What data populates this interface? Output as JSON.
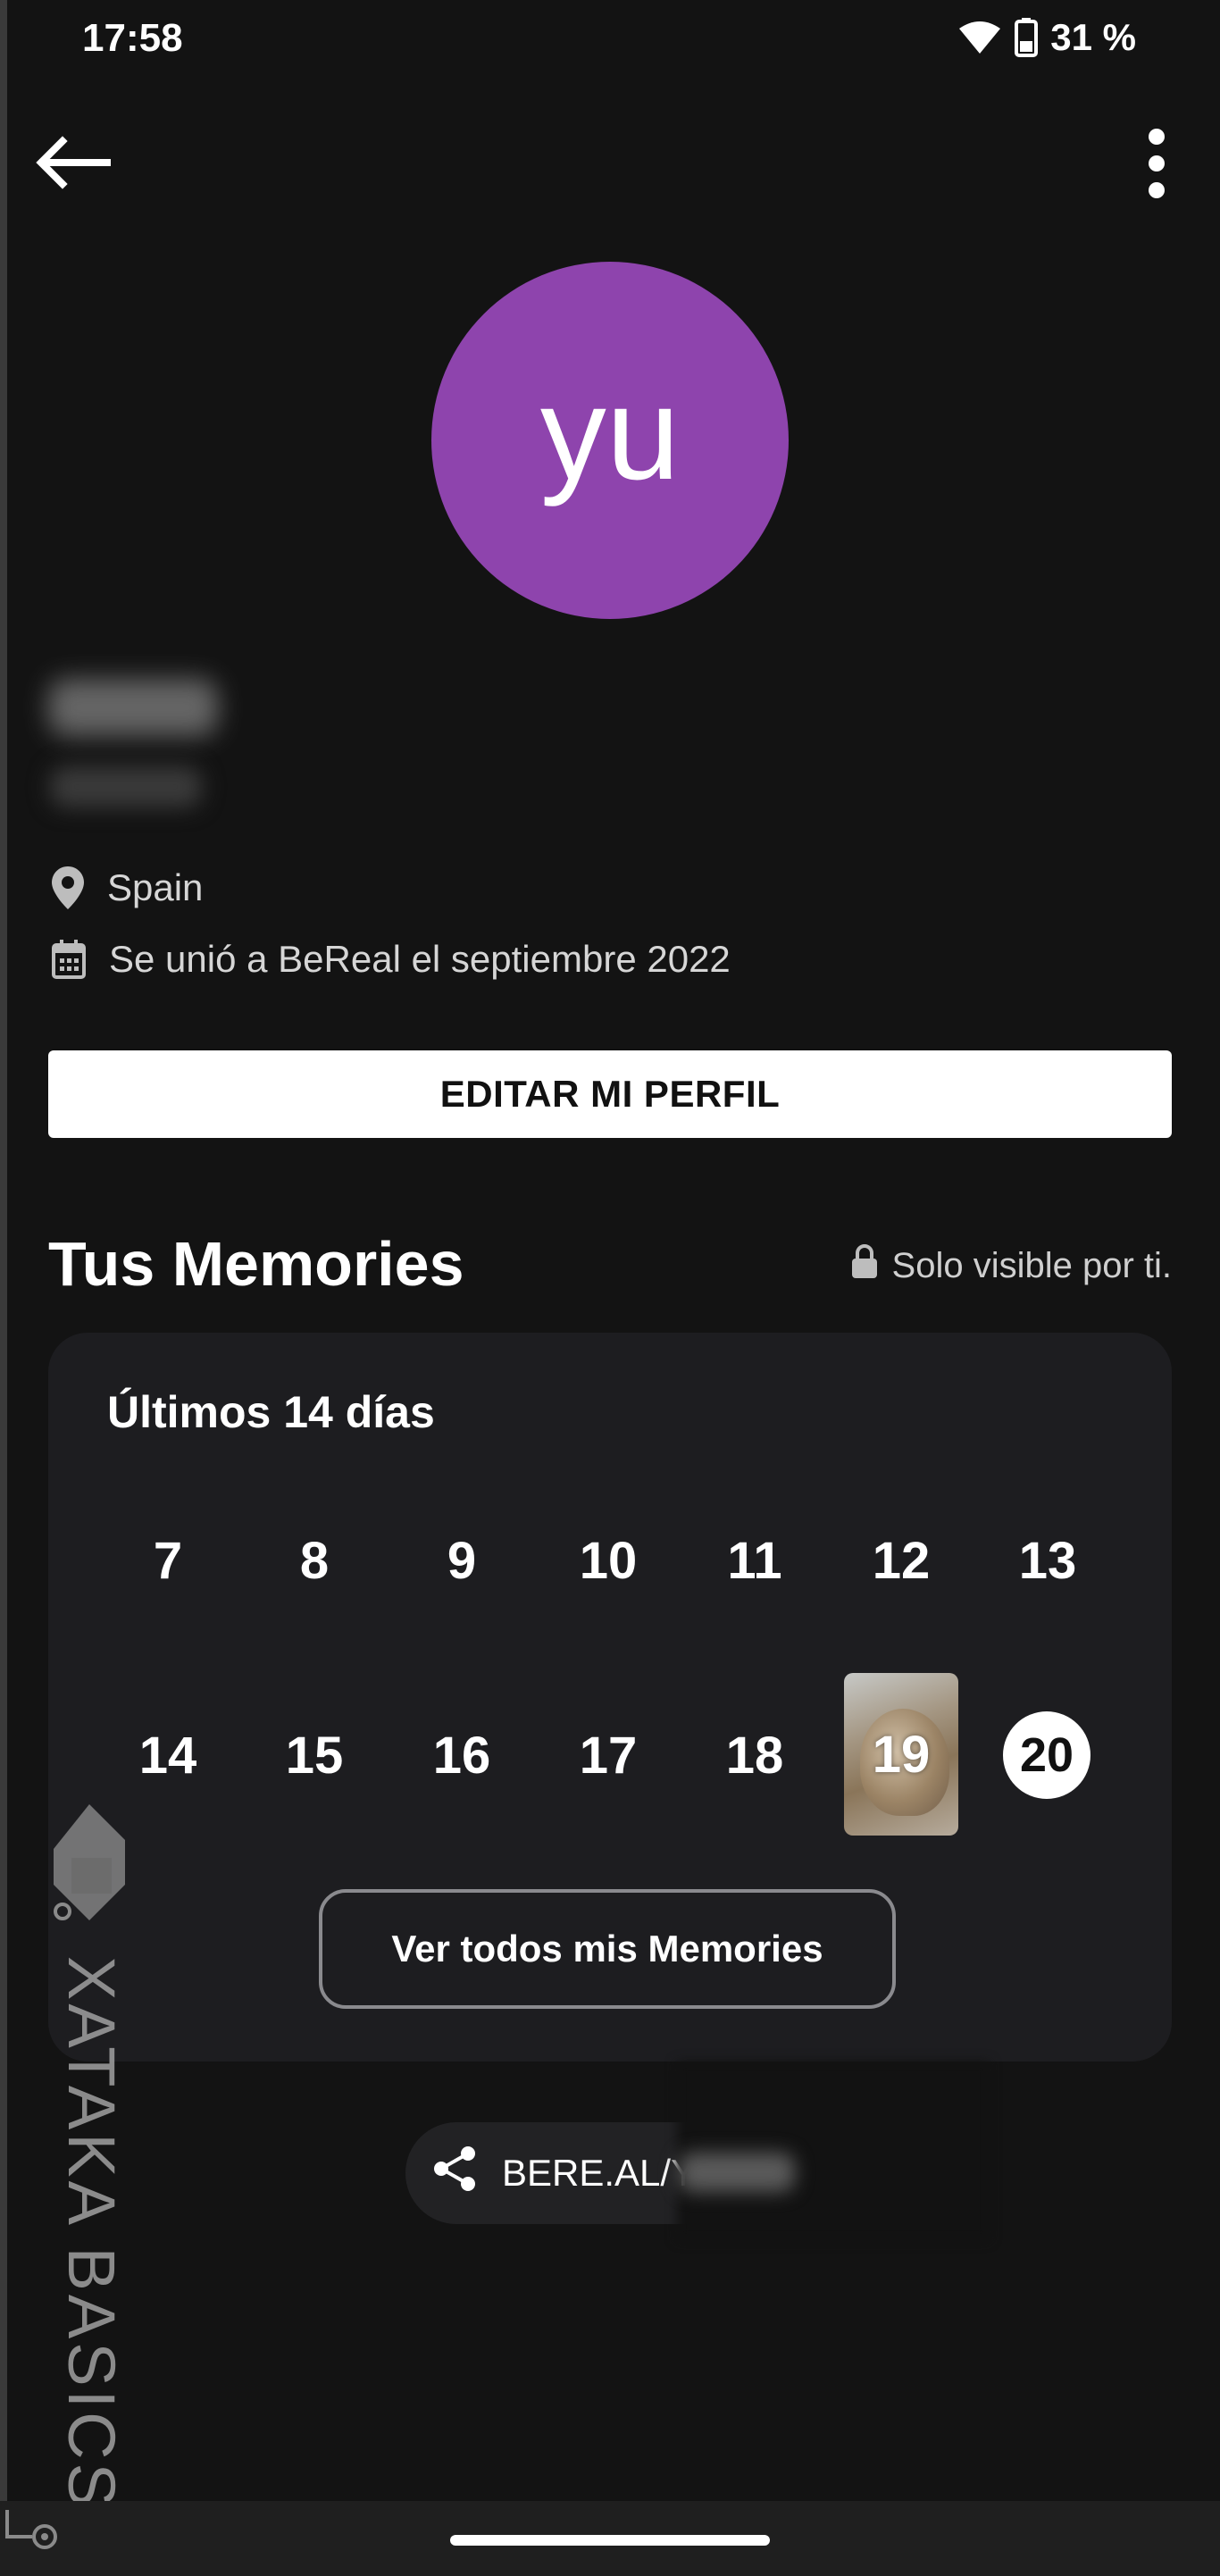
{
  "status_bar": {
    "time": "17:58",
    "battery": "31 %",
    "icons": [
      "wifi-icon",
      "battery-icon"
    ]
  },
  "top_bar": {
    "back_icon": "arrow-left-icon",
    "menu_icon": "more-vertical-icon"
  },
  "profile": {
    "avatar_initials": "yu",
    "avatar_color": "#8e44ad",
    "location": "Spain",
    "joined": "Se unió a BeReal el septiembre 2022"
  },
  "edit_profile_label": "EDITAR MI PERFIL",
  "memories": {
    "title": "Tus Memories",
    "visibility": "Solo visible por ti.",
    "subtitle": "Últimos 14 días",
    "week1": [
      "7",
      "8",
      "9",
      "10",
      "11",
      "12",
      "13"
    ],
    "week2": [
      "14",
      "15",
      "16",
      "17",
      "18"
    ],
    "photo_day": "19",
    "today": "20",
    "see_all_label": "Ver todos mis Memories"
  },
  "share": {
    "link_text": "BERE.AL/Y"
  },
  "watermark": {
    "text": "XATAKA BASICS"
  },
  "colors": {
    "background": "#131313",
    "card": "#1d1d20",
    "accent": "#8e44ad"
  }
}
